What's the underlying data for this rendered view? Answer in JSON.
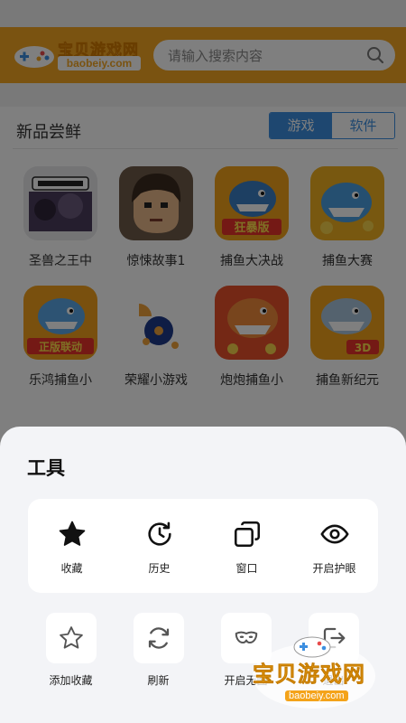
{
  "header": {
    "logo_cn": "宝贝游戏网",
    "logo_en": "baobeiy.com",
    "search_placeholder": "请输入搜索内容"
  },
  "section": {
    "title": "新品尝鲜",
    "tabs": [
      {
        "label": "游戏",
        "active": true
      },
      {
        "label": "软件",
        "active": false
      }
    ]
  },
  "games": [
    {
      "name": "圣兽之王中",
      "icon": "dark-fantasy-game-icon"
    },
    {
      "name": "惊悚故事1",
      "icon": "cartoon-face-game-icon"
    },
    {
      "name": "捕鱼大决战",
      "icon": "shark-game-icon"
    },
    {
      "name": "捕鱼大赛",
      "icon": "shark-game-icon"
    },
    {
      "name": "乐鸿捕鱼小",
      "icon": "shark-game-icon"
    },
    {
      "name": "荣耀小游戏",
      "icon": "abstract-dots-icon"
    },
    {
      "name": "炮炮捕鱼小",
      "icon": "shark-game-icon"
    },
    {
      "name": "捕鱼新纪元",
      "icon": "shark-game-icon"
    }
  ],
  "game_badges": {
    "badge_3": "狂暴版",
    "badge_5": "正版联动",
    "badge_8": "3D"
  },
  "sheet": {
    "title": "工具",
    "primary_tools": [
      {
        "label": "收藏",
        "icon": "star-filled-icon"
      },
      {
        "label": "历史",
        "icon": "history-clock-icon"
      },
      {
        "label": "窗口",
        "icon": "windows-icon"
      },
      {
        "label": "开启护眼",
        "icon": "eye-icon"
      }
    ],
    "secondary_tools": [
      {
        "label": "添加收藏",
        "icon": "star-outline-icon"
      },
      {
        "label": "刷新",
        "icon": "refresh-icon"
      },
      {
        "label": "开启无图",
        "icon": "mask-icon"
      },
      {
        "label": "退出",
        "icon": "exit-icon"
      }
    ]
  },
  "watermark": {
    "cn": "宝贝游戏网",
    "en": "baobeiy.com"
  },
  "colors": {
    "header_orange": "#f5a623",
    "tab_blue": "#3d8fe0",
    "sheet_bg": "#f3f4f7"
  }
}
